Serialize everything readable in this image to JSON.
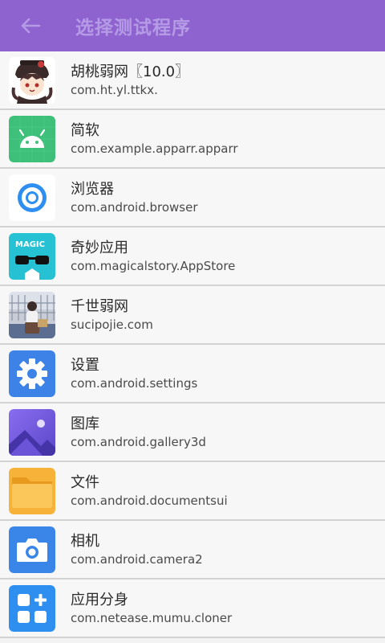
{
  "header": {
    "title": "选择测试程序"
  },
  "apps": [
    {
      "name": "胡桃弱网〖10.0〗",
      "package": "com.ht.yl.ttkx.",
      "icon": "hutao-avatar-icon"
    },
    {
      "name": "简软",
      "package": "com.example.apparr.apparr",
      "icon": "android-robot-icon"
    },
    {
      "name": "浏览器",
      "package": "com.android.browser",
      "icon": "browser-ring-icon"
    },
    {
      "name": "奇妙应用",
      "package": "com.magicalstory.AppStore",
      "icon": "magic-sunglasses-icon"
    },
    {
      "name": "千世弱网",
      "package": "sucipojie.com",
      "icon": "photo-person-icon"
    },
    {
      "name": "设置",
      "package": "com.android.settings",
      "icon": "settings-gear-icon"
    },
    {
      "name": "图库",
      "package": "com.android.gallery3d",
      "icon": "gallery-mountain-icon"
    },
    {
      "name": "文件",
      "package": "com.android.documentsui",
      "icon": "folder-icon"
    },
    {
      "name": "相机",
      "package": "com.android.camera2",
      "icon": "camera-icon"
    },
    {
      "name": "应用分身",
      "package": "com.netease.mumu.cloner",
      "icon": "app-cloner-grid-icon"
    }
  ],
  "icon_texts": {
    "magic": "MAGIC"
  },
  "colors": {
    "appbar": "#8f63cf",
    "title": "#b59be6"
  }
}
